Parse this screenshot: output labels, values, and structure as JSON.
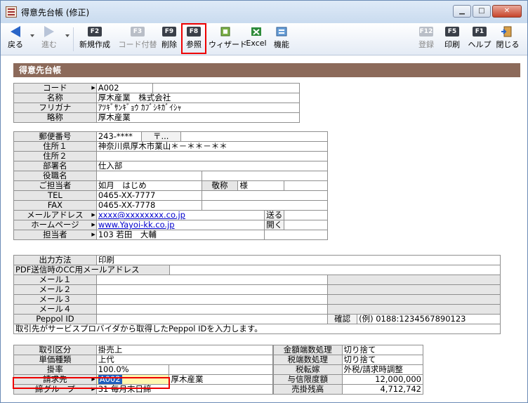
{
  "window": {
    "title": "得意先台帳 (修正)"
  },
  "toolbar": {
    "back": "戻る",
    "forward": "進む",
    "f2": {
      "key": "F2",
      "label": "新規作成"
    },
    "f3": {
      "key": "F3",
      "label": "コード付替"
    },
    "f9": {
      "key": "F9",
      "label": "削除"
    },
    "f8": {
      "key": "F8",
      "label": "参照"
    },
    "wizard": "ウィザード",
    "excel": "Excel",
    "functions": "機能",
    "f12": {
      "key": "F12",
      "label": "登録"
    },
    "f5": {
      "key": "F5",
      "label": "印刷"
    },
    "f1": {
      "key": "F1",
      "label": "ヘルプ"
    },
    "close": "閉じる"
  },
  "section": {
    "title": "得意先台帳"
  },
  "basic": {
    "code_label": "コード",
    "code": "A002",
    "name_label": "名称",
    "name": "厚木産業　株式会社",
    "kana_label": "フリガナ",
    "kana": "ｱﾂｷﾞｻﾝｷﾞｮｳ ｶﾌﾞｼｷｶﾞｲｼｬ",
    "short_label": "略称",
    "short": "厚木産業"
  },
  "contact": {
    "zip_label": "郵便番号",
    "zip": "243-****",
    "zip_btn": "〒...",
    "addr1_label": "住所１",
    "addr1": "神奈川県厚木市業山＊－＊＊－＊＊",
    "addr2_label": "住所２",
    "addr2": "",
    "dept_label": "部署名",
    "dept": "仕入部",
    "position_label": "役職名",
    "position": "",
    "person_label": "ご担当者",
    "person": "如月　はじめ",
    "honorific_label": "敬称",
    "honorific": "様",
    "tel_label": "TEL",
    "tel": "0465-XX-7777",
    "fax_label": "FAX",
    "fax": "0465-XX-7778",
    "mail_label": "メールアドレス",
    "mail": "xxxx@xxxxxxxx.co.jp",
    "mail_btn": "送る",
    "web_label": "ホームページ",
    "web": "www.Yayoi-kk.co.jp",
    "web_btn": "開く",
    "staff_label": "担当者",
    "staff": "103 若田　大輔"
  },
  "output": {
    "method_label": "出力方法",
    "method": "印刷",
    "cc_label": "PDF送信時のCC用メールアドレス",
    "mail1_label": "メール１",
    "mail2_label": "メール２",
    "mail3_label": "メール３",
    "mail4_label": "メール４",
    "peppol_label": "Peppol ID",
    "confirm_btn": "確認",
    "peppol_example": "(例) 0188:1234567890123",
    "note": "取引先がサービスプロバイダから取得したPeppol IDを入力します。"
  },
  "trade": {
    "kubun_label": "取引区分",
    "kubun": "掛売上",
    "price_label": "単価種類",
    "price": "上代",
    "rate_label": "掛率",
    "rate": "100.0%",
    "billto_label": "請求先",
    "billto_code": "A002",
    "billto_name": "厚木産業",
    "group_label": "締グループ",
    "group": "31 毎月末日締",
    "round_label": "金額端数処理",
    "round": "切り捨て",
    "taxround_label": "税端数処理",
    "taxround": "切り捨て",
    "taxmode_label": "税転嫁",
    "taxmode": "外税/請求時調整",
    "credit_label": "与信限度額",
    "credit": "12,000,000",
    "balance_label": "売掛残高",
    "balance": "4,712,742"
  }
}
